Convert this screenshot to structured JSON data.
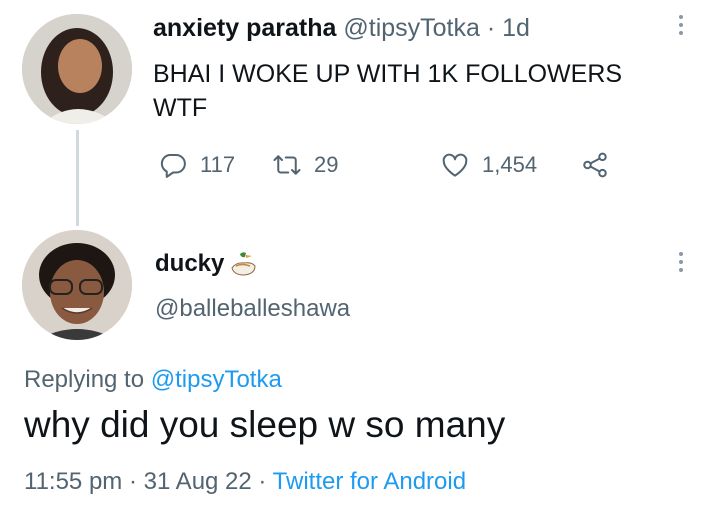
{
  "tweet1": {
    "display_name": "anxiety paratha",
    "handle": "@tipsyTotka",
    "separator": "·",
    "time": "1d",
    "text_line1": "BHAI I WOKE UP WITH 1K FOLLOWERS",
    "text_line2": "WTF",
    "replies": "117",
    "retweets": "29",
    "likes": "1,454"
  },
  "tweet2": {
    "display_name": "ducky",
    "name_emoji_icon": "duck-emoji-icon",
    "handle": "@balleballeshawa",
    "replying_prefix": "Replying to",
    "replying_to": "@tipsyTotka",
    "text": "why did you sleep w so many",
    "time": "11:55 pm",
    "separator": "·",
    "date": "31 Aug 22",
    "source": "Twitter for Android"
  },
  "colors": {
    "text": "#0f1419",
    "muted": "#536471",
    "link": "#1d9bf0",
    "thread_line": "#cfd9de"
  },
  "icons": [
    "reply-icon",
    "retweet-icon",
    "like-icon",
    "share-icon",
    "more-options-icon"
  ]
}
